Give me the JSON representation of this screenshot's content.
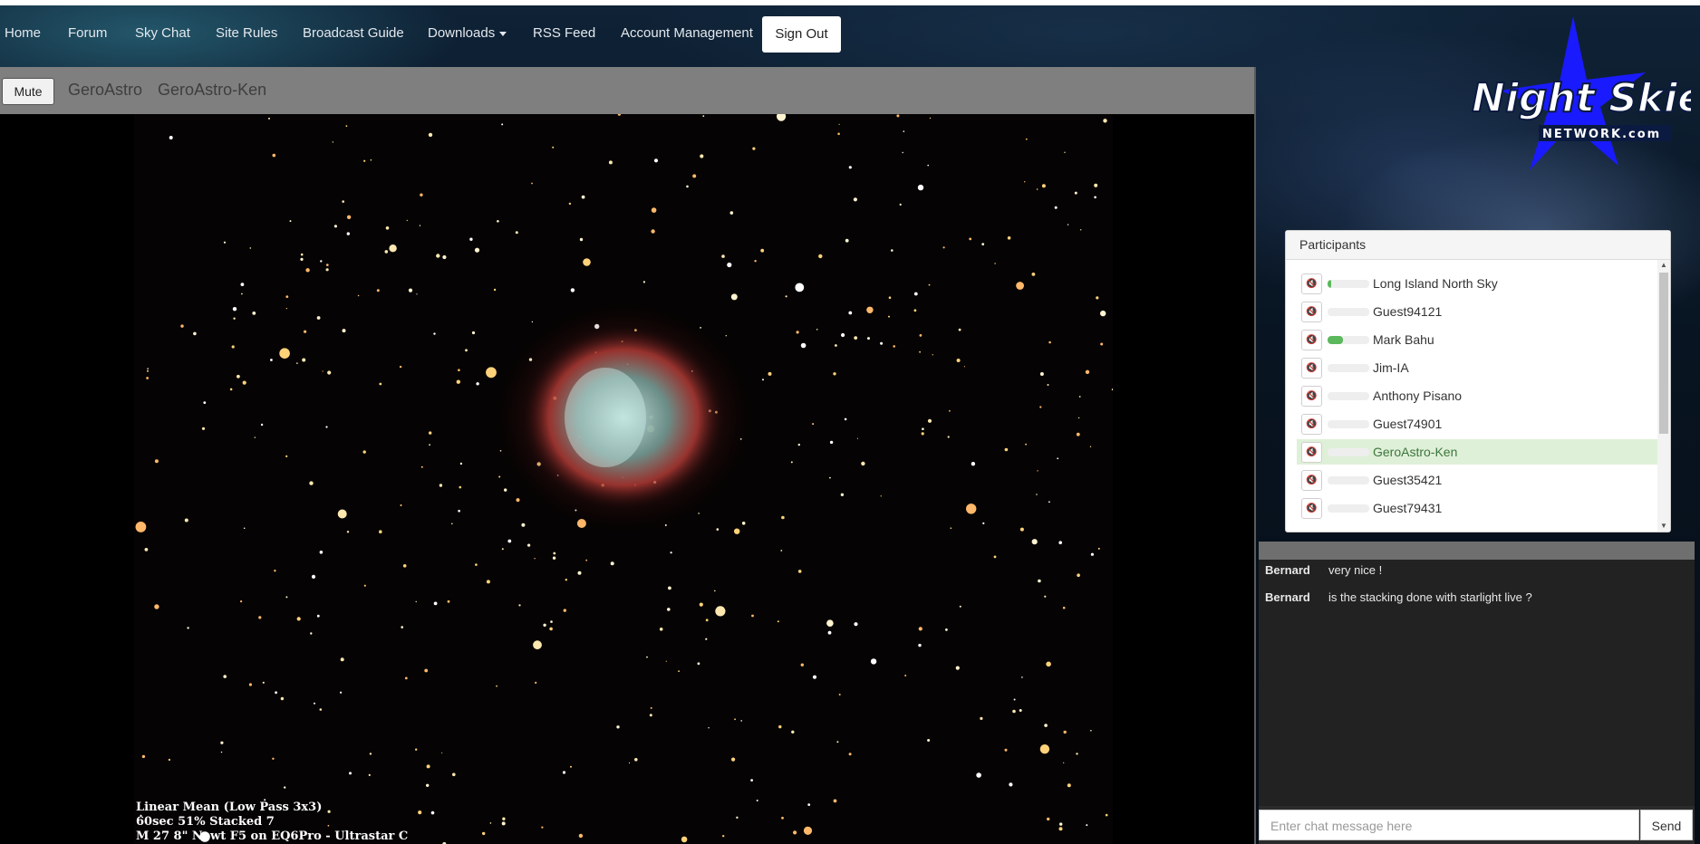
{
  "nav": {
    "items": [
      "Home",
      "Forum",
      "Sky Chat",
      "Site Rules",
      "Broadcast Guide",
      "Downloads",
      "RSS Feed",
      "Account Management"
    ],
    "signout_label": "Sign Out"
  },
  "logo": {
    "text": "Night Skies",
    "subtext": "NETWORK.com"
  },
  "viewer": {
    "mute_label": "Mute",
    "channel": "GeroAstro",
    "broadcaster": "GeroAstro-Ken",
    "caption": [
      "Linear Mean (Low Pass 3x3)",
      "60sec 51% Stacked 7",
      "M 27 8\" Newt F5 on EQ6Pro - Ultrastar C"
    ]
  },
  "participants": {
    "title": "Participants",
    "users": [
      {
        "name": "Long Island North Sky",
        "level": 0.08,
        "active": false
      },
      {
        "name": "Guest94121",
        "level": 0,
        "active": false
      },
      {
        "name": "Mark Bahu",
        "level": 0.38,
        "active": false
      },
      {
        "name": "Jim-IA",
        "level": 0,
        "active": false
      },
      {
        "name": "Anthony Pisano",
        "level": 0,
        "active": false
      },
      {
        "name": "Guest74901",
        "level": 0,
        "active": false
      },
      {
        "name": "GeroAstro-Ken",
        "level": 0,
        "active": true
      },
      {
        "name": "Guest35421",
        "level": 0,
        "active": false
      },
      {
        "name": "Guest79431",
        "level": 0,
        "active": false
      }
    ]
  },
  "chat": {
    "messages": [
      {
        "user": "Bernard",
        "text": "very nice !"
      },
      {
        "user": "Bernard",
        "text": "is the stacking done with starlight live ?"
      }
    ],
    "input_placeholder": "Enter chat message here",
    "send_label": "Send"
  },
  "colors": {
    "accent_green": "#5cb85c",
    "active_row": "#dff0d8",
    "logo_star": "#1a1aff"
  },
  "icons": {
    "speaker_mute": "volume-mute-icon"
  }
}
